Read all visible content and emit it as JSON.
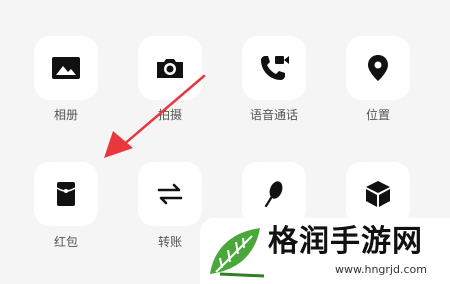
{
  "panel": {
    "row1": [
      {
        "label": "相册",
        "icon": "image-icon"
      },
      {
        "label": "拍摄",
        "icon": "camera-icon"
      },
      {
        "label": "语音通话",
        "icon": "phone-video-icon"
      },
      {
        "label": "位置",
        "icon": "location-pin-icon"
      }
    ],
    "row2": [
      {
        "label": "红包",
        "icon": "red-packet-icon"
      },
      {
        "label": "转账",
        "icon": "transfer-arrows-icon"
      },
      {
        "label": "",
        "icon": "microphone-icon"
      },
      {
        "label": "",
        "icon": "cube-icon"
      }
    ]
  },
  "annotation": {
    "color": "#e8383d",
    "points_to": "红包"
  },
  "watermark": {
    "text": "格润手游网",
    "url": "www.hngrjd.com"
  },
  "colors": {
    "background": "#f5f5f5",
    "tile": "#ffffff",
    "icon": "#111111",
    "label": "#555555"
  }
}
